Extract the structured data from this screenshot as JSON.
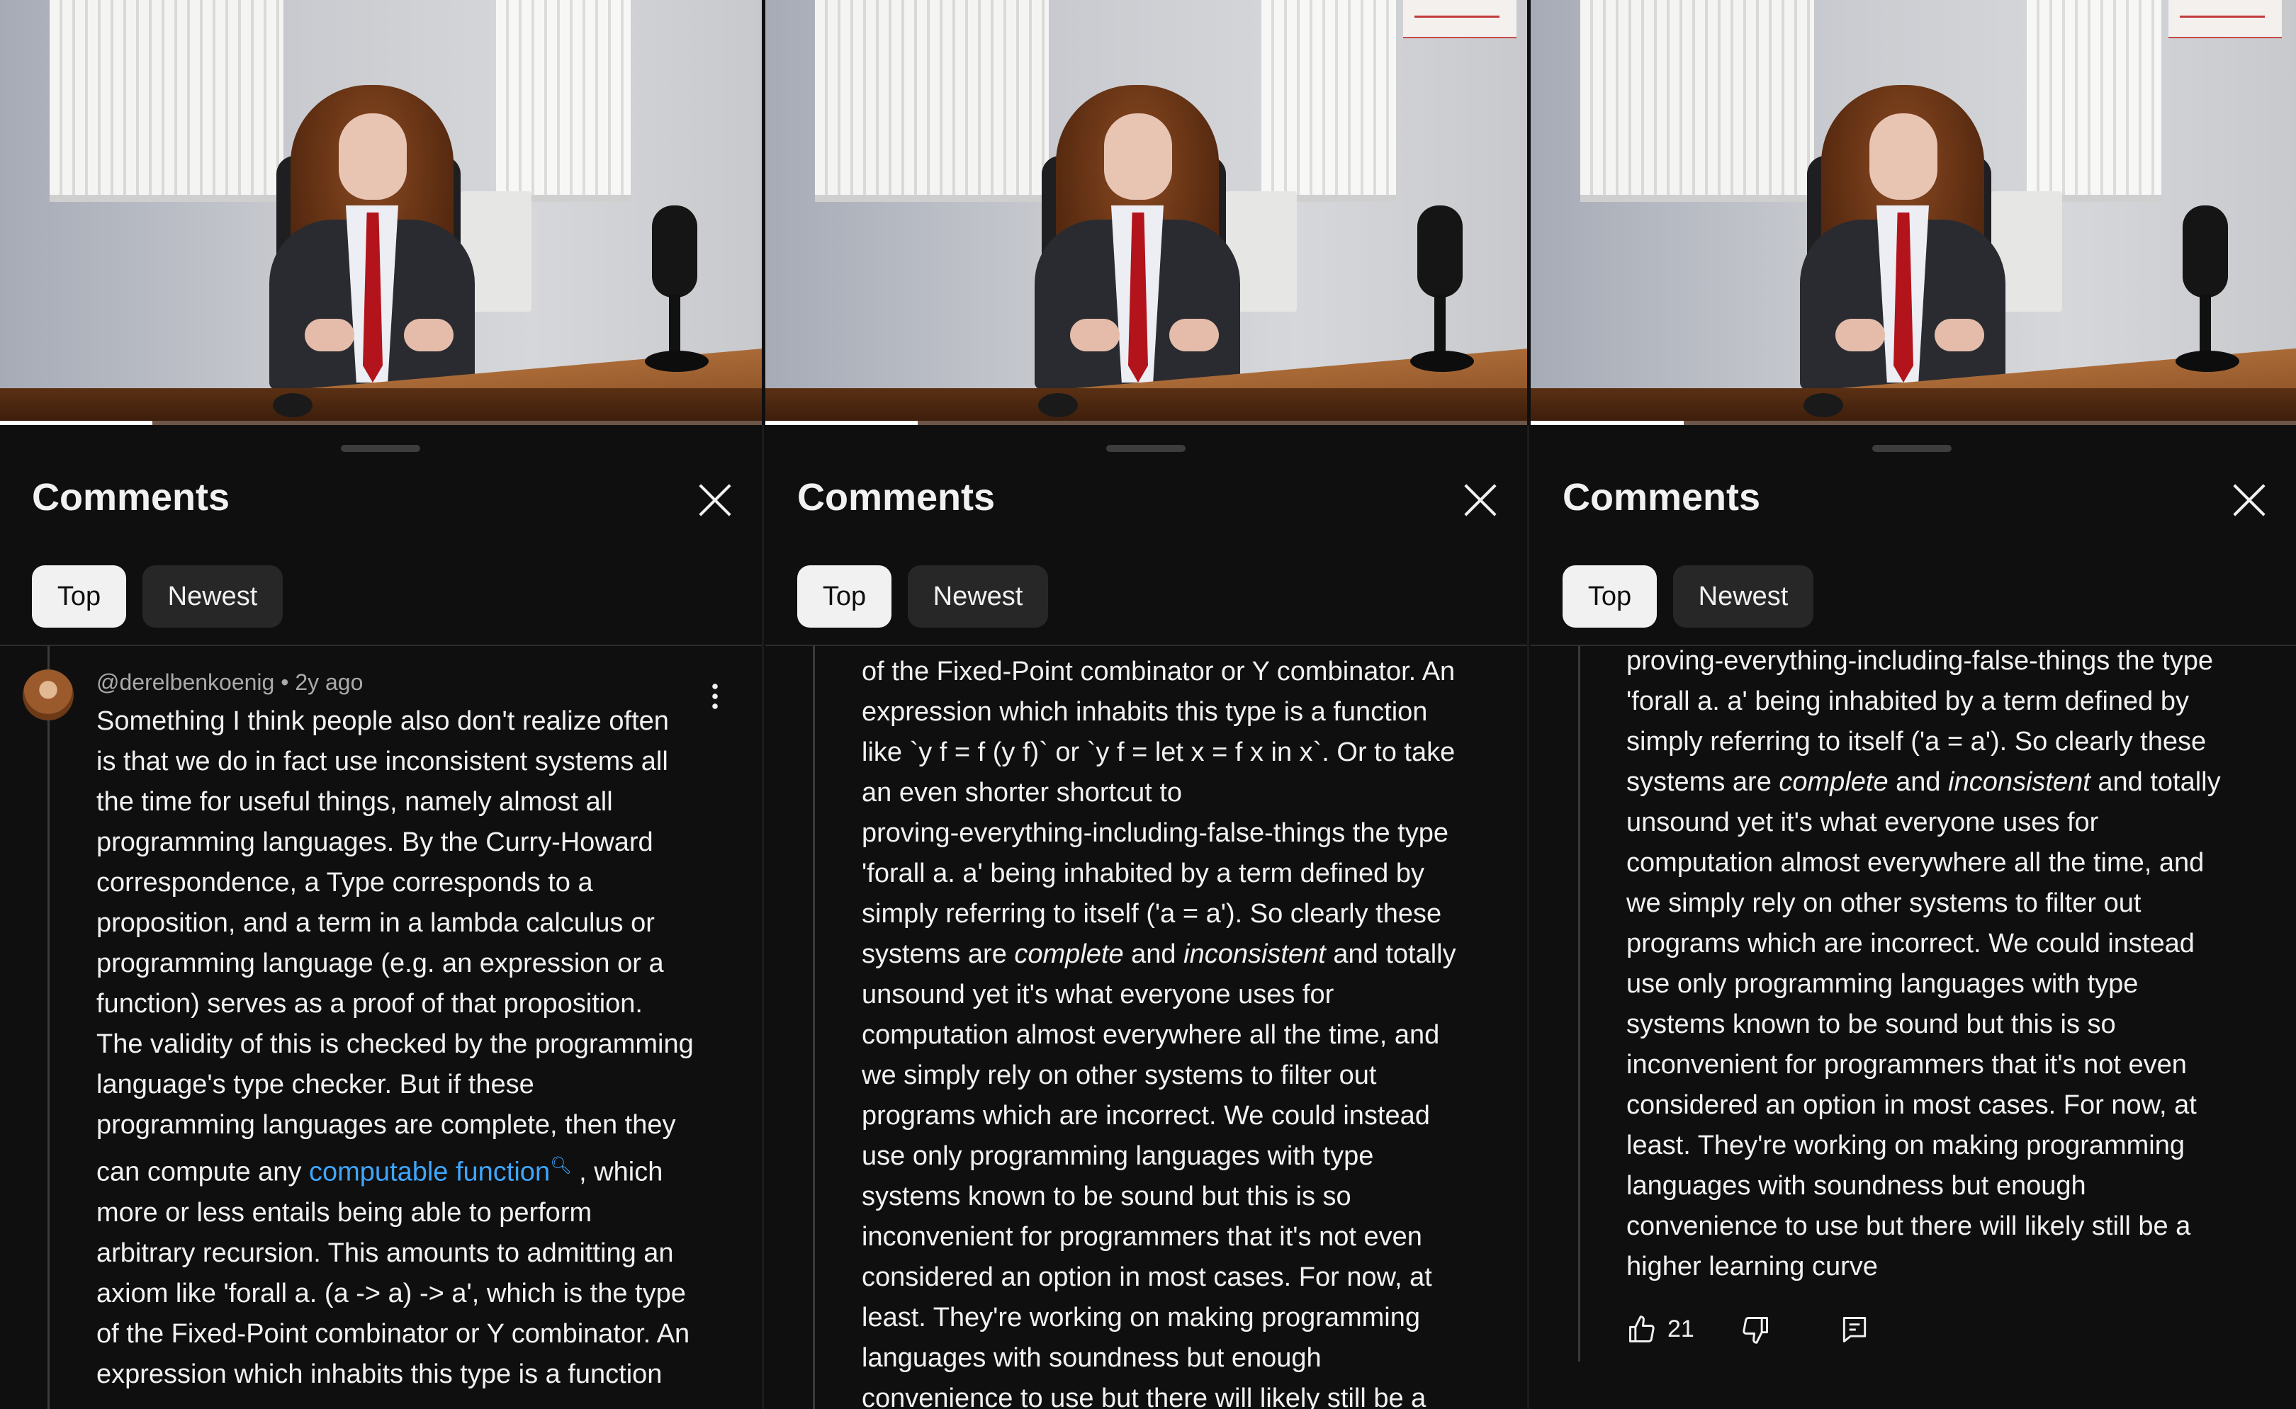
{
  "screens": [
    {
      "video": {
        "progress_fraction": 0.2
      },
      "comments": {
        "title": "Comments",
        "tabs": {
          "top": "Top",
          "newest": "Newest"
        },
        "author": "@derelbenkoenig",
        "separator": "•",
        "time": "2y ago",
        "lines": [
          "Something I think people also don't realize often",
          "is that we do in fact use inconsistent systems all",
          "the time for useful things, namely almost all",
          "programming languages. By the Curry-Howard",
          "correspondence, a Type corresponds to a",
          "proposition, and a term in a lambda calculus or",
          "programming language (e.g. an expression or a",
          "function) serves as a proof of that proposition.",
          "The validity of this is checked by the programming",
          "language's type checker. But if these",
          "programming languages are complete, then they"
        ],
        "link_line": {
          "before": "can compute any ",
          "link": "computable function",
          "after": " , which"
        },
        "lines_after": [
          "more or less entails being able to perform",
          "arbitrary recursion. This amounts to admitting an",
          "axiom like 'forall a. (a -> a) -> a', which is the type",
          "of the Fixed-Point combinator or Y combinator. An",
          "expression which inhabits this type is a function"
        ]
      }
    },
    {
      "video": {
        "progress_fraction": 0.2
      },
      "comments": {
        "title": "Comments",
        "tabs": {
          "top": "Top",
          "newest": "Newest"
        },
        "lines_a": [
          "of the Fixed-Point combinator or Y combinator. An",
          "expression which inhabits this type is a function",
          "like `y f = f (y f)` or `y f = let x = f x in x`. Or to take",
          "an even shorter shortcut to",
          "proving-everything-including-false-things the type",
          "'forall a. a' being inhabited by a term defined by",
          "simply referring to itself ('a = a'). So clearly these"
        ],
        "emph_line": {
          "before": "systems are ",
          "complete": "complete",
          "and": " and ",
          "inconsistent": "inconsistent",
          "after": " and totally"
        },
        "lines_b": [
          "unsound yet it's what everyone uses for",
          "computation almost everywhere all the time, and",
          "we simply rely on other systems to filter out",
          "programs which are incorrect. We could instead",
          "use only programming languages with type",
          "systems known to be sound but this is so",
          "inconvenient for programmers that it's not even",
          "considered an option in most cases. For now, at",
          "least. They're working on making programming",
          "languages with soundness but enough",
          "convenience to use but there will likely still be a"
        ]
      }
    },
    {
      "video": {
        "progress_fraction": 0.2
      },
      "comments": {
        "title": "Comments",
        "tabs": {
          "top": "Top",
          "newest": "Newest"
        },
        "lines_a": [
          "proving-everything-including-false-things the type",
          "'forall a. a' being inhabited by a term defined by",
          "simply referring to itself ('a = a'). So clearly these"
        ],
        "emph_line": {
          "before": "systems are ",
          "complete": "complete",
          "and": " and ",
          "inconsistent": "inconsistent",
          "after": " and totally"
        },
        "lines_b": [
          "unsound yet it's what everyone uses for",
          "computation almost everywhere all the time, and",
          "we simply rely on other systems to filter out",
          "programs which are incorrect. We could instead",
          "use only programming languages with type",
          "systems known to be sound but this is so",
          "inconvenient for programmers that it's not even",
          "considered an option in most cases. For now, at",
          "least. They're working on making programming",
          "languages with soundness but enough",
          "convenience to use but there will likely still be a",
          "higher learning curve"
        ],
        "likes": "21",
        "icons": {
          "like": "thumbs-up-icon",
          "dislike": "thumbs-down-icon",
          "reply": "reply-icon"
        }
      }
    }
  ]
}
